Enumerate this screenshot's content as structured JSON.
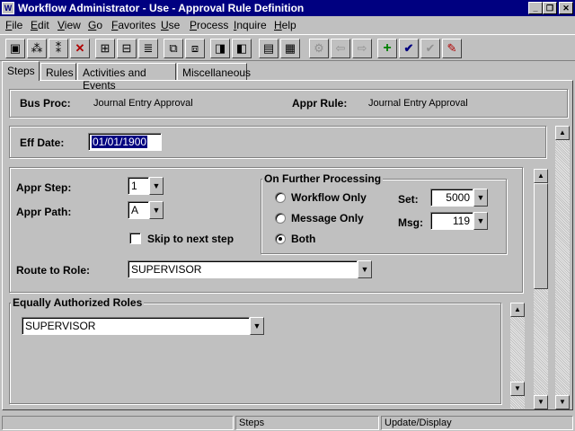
{
  "window": {
    "title": "Workflow Administrator - Use - Approval Rule Definition",
    "icon": "app-icon",
    "minimize": "_",
    "restore": "❐",
    "close": "✕"
  },
  "menu": [
    "File",
    "Edit",
    "View",
    "Go",
    "Favorites",
    "Use",
    "Process",
    "Inquire",
    "Help"
  ],
  "tabs": [
    "Steps",
    "Rules",
    "Activities and Events",
    "Miscellaneous"
  ],
  "header": {
    "bus_proc_label": "Bus Proc:",
    "bus_proc_value": "Journal Entry Approval",
    "appr_rule_label": "Appr Rule:",
    "appr_rule_value": "Journal Entry Approval"
  },
  "eff_date": {
    "label": "Eff Date:",
    "value": "01/01/1900"
  },
  "step": {
    "appr_step_label": "Appr Step:",
    "appr_step_value": "1",
    "appr_path_label": "Appr Path:",
    "appr_path_value": "A",
    "skip_label": "Skip to next step",
    "route_label": "Route to Role:",
    "route_value": "SUPERVISOR"
  },
  "further": {
    "legend": "On Further Processing",
    "options": [
      "Workflow Only",
      "Message Only",
      "Both"
    ],
    "selected": "Both",
    "set_label": "Set:",
    "set_value": "5000",
    "msg_label": "Msg:",
    "msg_value": "119"
  },
  "equal_roles": {
    "legend": "Equally Authorized Roles",
    "value": "SUPERVISOR"
  },
  "status": {
    "panel1": "",
    "panel2": "Steps",
    "panel3": "Update/Display"
  },
  "colors": {
    "titlebar": "#000080",
    "face": "#c0c0c0",
    "selection": "#000080"
  }
}
